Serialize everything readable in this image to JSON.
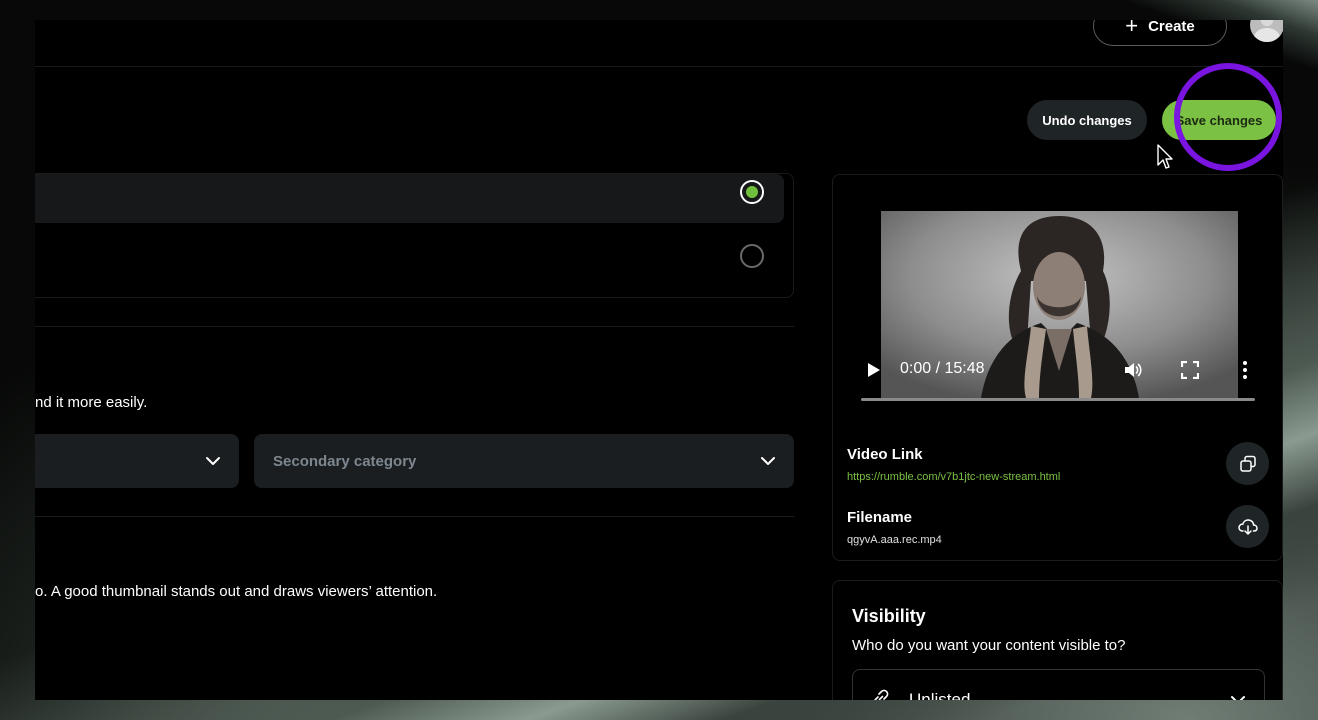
{
  "header": {
    "create_label": "Create",
    "undo_label": "Undo changes",
    "save_label": "Save changes"
  },
  "form": {
    "category_hint": "nd it more easily.",
    "secondary_category_placeholder": "Secondary category",
    "thumbnail_hint": "o. A good thumbnail stands out and draws viewers’ attention."
  },
  "player": {
    "time": "0:00 / 15:48",
    "progress": 0
  },
  "media": {
    "video_link_label": "Video Link",
    "video_link_url": "https://rumble.com/v7b1jtc-new-stream.html",
    "filename_label": "Filename",
    "filename_value": "qgyvA.aaa.rec.mp4"
  },
  "visibility": {
    "title": "Visibility",
    "question": "Who do you want your content visible to?",
    "selected": "Unlisted"
  },
  "colors": {
    "accent_green": "#7bc143",
    "highlight_purple": "#7a14e0",
    "link_green": "#7bc143"
  },
  "icons": {
    "create": "plus-icon",
    "copy": "copy-icon",
    "download": "cloud-download-icon",
    "visibility": "link-icon"
  }
}
